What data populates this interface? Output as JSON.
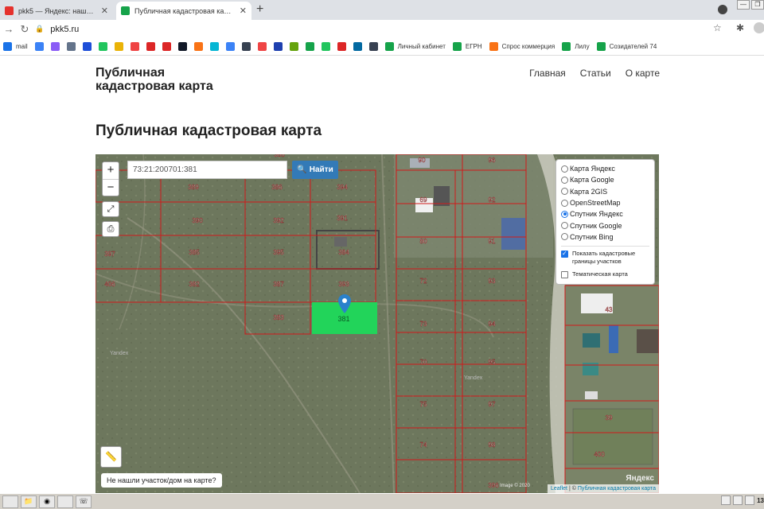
{
  "browser": {
    "tabs": [
      {
        "title": "pkk5 — Яндекс: нашлось 22 млн р",
        "active": false,
        "favicon_color": "#e5322d"
      },
      {
        "title": "Публичная кадастровая карта Рос",
        "active": true,
        "favicon_color": "#16a34a"
      }
    ],
    "url": "pkk5.ru",
    "bookmarks": [
      {
        "label": "mail",
        "icon_color": "#1a73e8"
      },
      {
        "label": "",
        "icon_color": "#3b82f6"
      },
      {
        "label": "",
        "icon_color": "#8b5cf6"
      },
      {
        "label": "",
        "icon_color": "#64748b"
      },
      {
        "label": "",
        "icon_color": "#1d4ed8"
      },
      {
        "label": "",
        "icon_color": "#22c55e"
      },
      {
        "label": "",
        "icon_color": "#eab308"
      },
      {
        "label": "",
        "icon_color": "#ef4444"
      },
      {
        "label": "",
        "icon_color": "#dc2626"
      },
      {
        "label": "",
        "icon_color": "#dc2626"
      },
      {
        "label": "",
        "icon_color": "#111827"
      },
      {
        "label": "",
        "icon_color": "#f97316"
      },
      {
        "label": "",
        "icon_color": "#06b6d4"
      },
      {
        "label": "",
        "icon_color": "#3b82f6"
      },
      {
        "label": "",
        "icon_color": "#374151"
      },
      {
        "label": "",
        "icon_color": "#ef4444"
      },
      {
        "label": "",
        "icon_color": "#1e40af"
      },
      {
        "label": "",
        "icon_color": "#65a30d"
      },
      {
        "label": "",
        "icon_color": "#16a34a"
      },
      {
        "label": "",
        "icon_color": "#22c55e"
      },
      {
        "label": "",
        "icon_color": "#dc2626"
      },
      {
        "label": "",
        "icon_color": "#0369a1"
      },
      {
        "label": "",
        "icon_color": "#374151"
      },
      {
        "label": "Личный кабинет",
        "icon_color": "#16a34a"
      },
      {
        "label": "ЕГРН",
        "icon_color": "#16a34a"
      },
      {
        "label": "Спрос коммерция",
        "icon_color": "#f97316"
      },
      {
        "label": "Лилу",
        "icon_color": "#16a34a"
      },
      {
        "label": "Созидателей 74",
        "icon_color": "#16a34a"
      }
    ]
  },
  "site": {
    "brand": "Публичная\nкадастровая карта",
    "nav": [
      "Главная",
      "Статьи",
      "О карте"
    ],
    "title": "Публичная кадастровая карта"
  },
  "map": {
    "search_value": "73:21:200701:381",
    "search_button": "Найти",
    "zoom_in": "+",
    "zoom_out": "−",
    "layers": [
      {
        "label": "Карта Яндекс",
        "selected": false
      },
      {
        "label": "Карта Google",
        "selected": false
      },
      {
        "label": "Карта 2GIS",
        "selected": false
      },
      {
        "label": "OpenStreetMap",
        "selected": false
      },
      {
        "label": "Спутник Яндекс",
        "selected": true
      },
      {
        "label": "Спутник Google",
        "selected": false
      },
      {
        "label": "Спутник Bing",
        "selected": false
      }
    ],
    "options": [
      {
        "label": "Показать кадастровые границы участков",
        "checked": true
      },
      {
        "label": "Тематическая карта",
        "checked": false
      }
    ],
    "not_found": "Не нашли участок/дом на карте?",
    "attribution_link1": "Leaflet",
    "attribution_link2": "Публичная кадастровая карта",
    "yandex_logo": "Яндекс",
    "watermark": "Yandex",
    "image_credit": "Image © 2020",
    "selected_parcel_label": "381",
    "parcel_labels": [
      "388",
      "389",
      "386",
      "394",
      "390",
      "392",
      "391",
      "397",
      "385",
      "395",
      "384",
      "406",
      "382",
      "387",
      "393",
      "383",
      "90",
      "96",
      "69",
      "92",
      "80",
      "91",
      "72",
      "93",
      "73",
      "94",
      "70",
      "95",
      "75",
      "97",
      "74",
      "98",
      "396",
      "43",
      "39",
      "400"
    ]
  },
  "taskbar": {
    "clock": "13"
  }
}
